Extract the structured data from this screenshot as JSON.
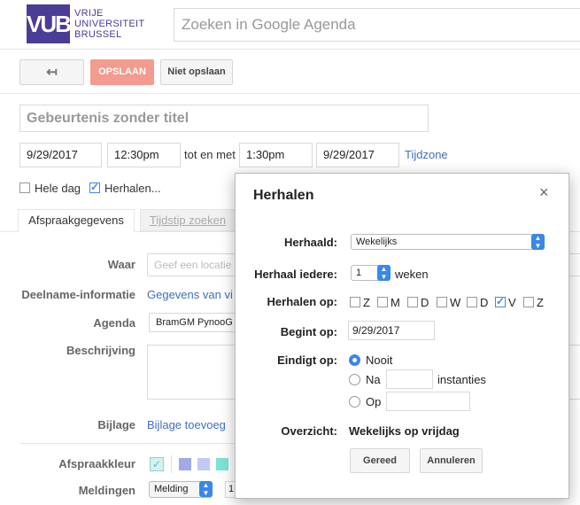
{
  "header": {
    "logo_short": "VUB",
    "logo_lines": [
      "VRIJE",
      "UNIVERSITEIT",
      "BRUSSEL"
    ],
    "search_placeholder": "Zoeken in Google Agenda"
  },
  "toolbar": {
    "back_icon": "↤",
    "save_label": "OPSLAAN",
    "nosave_label": "Niet opslaan"
  },
  "event": {
    "title_placeholder": "Gebeurtenis zonder titel",
    "start_date": "9/29/2017",
    "start_time": "12:30pm",
    "to_label": "tot en met",
    "end_time": "1:30pm",
    "end_date": "9/29/2017",
    "timezone_link": "Tijdzone",
    "allday_label": "Hele dag",
    "repeat_label": "Herhalen..."
  },
  "tabs": [
    "Afspraakgegevens",
    "Tijdstip zoeken"
  ],
  "details": {
    "where_label": "Waar",
    "where_placeholder": "Geef een locatie",
    "conf_label": "Deelname-informatie",
    "conf_value": "Gegevens van vi",
    "calendar_label": "Agenda",
    "calendar_value": "BramGM PynooG",
    "desc_label": "Beschrijving",
    "attach_label": "Bijlage",
    "attach_value": "Bijlage toevoeg",
    "color_label": "Afspraakkleur",
    "colors": [
      "#a0d6e8",
      "#a5a8e8",
      "#c3c9f5",
      "#7ee2d6"
    ],
    "notif_label": "Meldingen",
    "notif_value": "Melding",
    "notif_num": "1"
  },
  "dialog": {
    "title": "Herhalen",
    "close_icon": "×",
    "repeats_label": "Herhaald:",
    "repeats_value": "Wekelijks",
    "every_label": "Herhaal iedere:",
    "every_value": "1",
    "every_unit": "weken",
    "on_label": "Herhalen op:",
    "days": [
      {
        "letter": "Z",
        "checked": false
      },
      {
        "letter": "M",
        "checked": false
      },
      {
        "letter": "D",
        "checked": false
      },
      {
        "letter": "W",
        "checked": false
      },
      {
        "letter": "D",
        "checked": false
      },
      {
        "letter": "V",
        "checked": true
      },
      {
        "letter": "Z",
        "checked": false
      }
    ],
    "starts_label": "Begint op:",
    "starts_value": "9/29/2017",
    "ends_label": "Eindigt op:",
    "never_label": "Nooit",
    "after_label": "Na",
    "after_unit": "instanties",
    "on_date_label": "Op",
    "summary_label": "Overzicht:",
    "summary_value": "Wekelijks op vrijdag",
    "done_label": "Gereed",
    "cancel_label": "Annuleren"
  }
}
